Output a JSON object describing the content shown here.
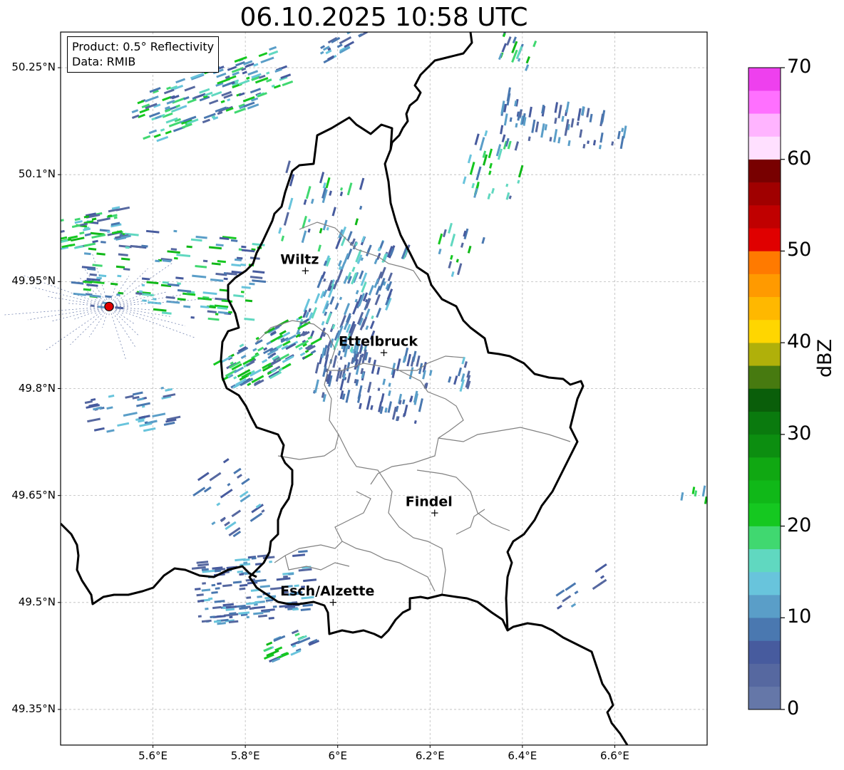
{
  "title": "06.10.2025 10:58 UTC",
  "info_box": {
    "product": "Product: 0.5° Reflectivity",
    "source": "Data: RMIB"
  },
  "map": {
    "lon_range": [
      5.4,
      6.8
    ],
    "lat_range": [
      49.3,
      50.3
    ],
    "lat_ticks": [
      {
        "value": 50.25,
        "label": "50.25°N"
      },
      {
        "value": 50.1,
        "label": "50.1°N"
      },
      {
        "value": 49.95,
        "label": "49.95°N"
      },
      {
        "value": 49.8,
        "label": "49.8°N"
      },
      {
        "value": 49.65,
        "label": "49.65°N"
      },
      {
        "value": 49.5,
        "label": "49.5°N"
      },
      {
        "value": 49.35,
        "label": "49.35°N"
      }
    ],
    "lon_ticks": [
      {
        "value": 5.6,
        "label": "5.6°E"
      },
      {
        "value": 5.8,
        "label": "5.8°E"
      },
      {
        "value": 6.0,
        "label": "6°E"
      },
      {
        "value": 6.2,
        "label": "6.2°E"
      },
      {
        "value": 6.4,
        "label": "6.4°E"
      },
      {
        "value": 6.6,
        "label": "6.6°E"
      }
    ],
    "gridlines": true,
    "cities": [
      {
        "name": "Wiltz",
        "lon": 5.93,
        "lat": 49.965
      },
      {
        "name": "Ettelbruck",
        "lon": 6.1,
        "lat": 49.85
      },
      {
        "name": "Findel",
        "lon": 6.21,
        "lat": 49.625
      },
      {
        "name": "Esch/Alzette",
        "lon": 5.99,
        "lat": 49.5
      }
    ],
    "radar_site": {
      "lon": 5.505,
      "lat": 49.915,
      "color": "#e00000"
    },
    "border_color": "#000000",
    "district_color": "#808080"
  },
  "colorbar": {
    "label": "dBZ",
    "ticks": [
      {
        "value": 0,
        "label": "0"
      },
      {
        "value": 10,
        "label": "10"
      },
      {
        "value": 20,
        "label": "20"
      },
      {
        "value": 30,
        "label": "30"
      },
      {
        "value": 40,
        "label": "40"
      },
      {
        "value": 50,
        "label": "50"
      },
      {
        "value": 60,
        "label": "60"
      },
      {
        "value": 70,
        "label": "70"
      }
    ],
    "min": 0,
    "max": 70,
    "step": 2.5,
    "colors": [
      "#6577a8",
      "#5668a0",
      "#475b9e",
      "#4a78b0",
      "#5a9ec8",
      "#68c4dc",
      "#60d8c0",
      "#40d870",
      "#15c820",
      "#10b818",
      "#10a812",
      "#0c8e10",
      "#0a7a0e",
      "#0a5e0a",
      "#477a10",
      "#b0b00a",
      "#ffd600",
      "#ffb800",
      "#ff9a00",
      "#ff7a00",
      "#e00000",
      "#c00000",
      "#a00000",
      "#780000",
      "#ffe0ff",
      "#ffb4ff",
      "#ff70ff",
      "#ee40ee"
    ]
  }
}
